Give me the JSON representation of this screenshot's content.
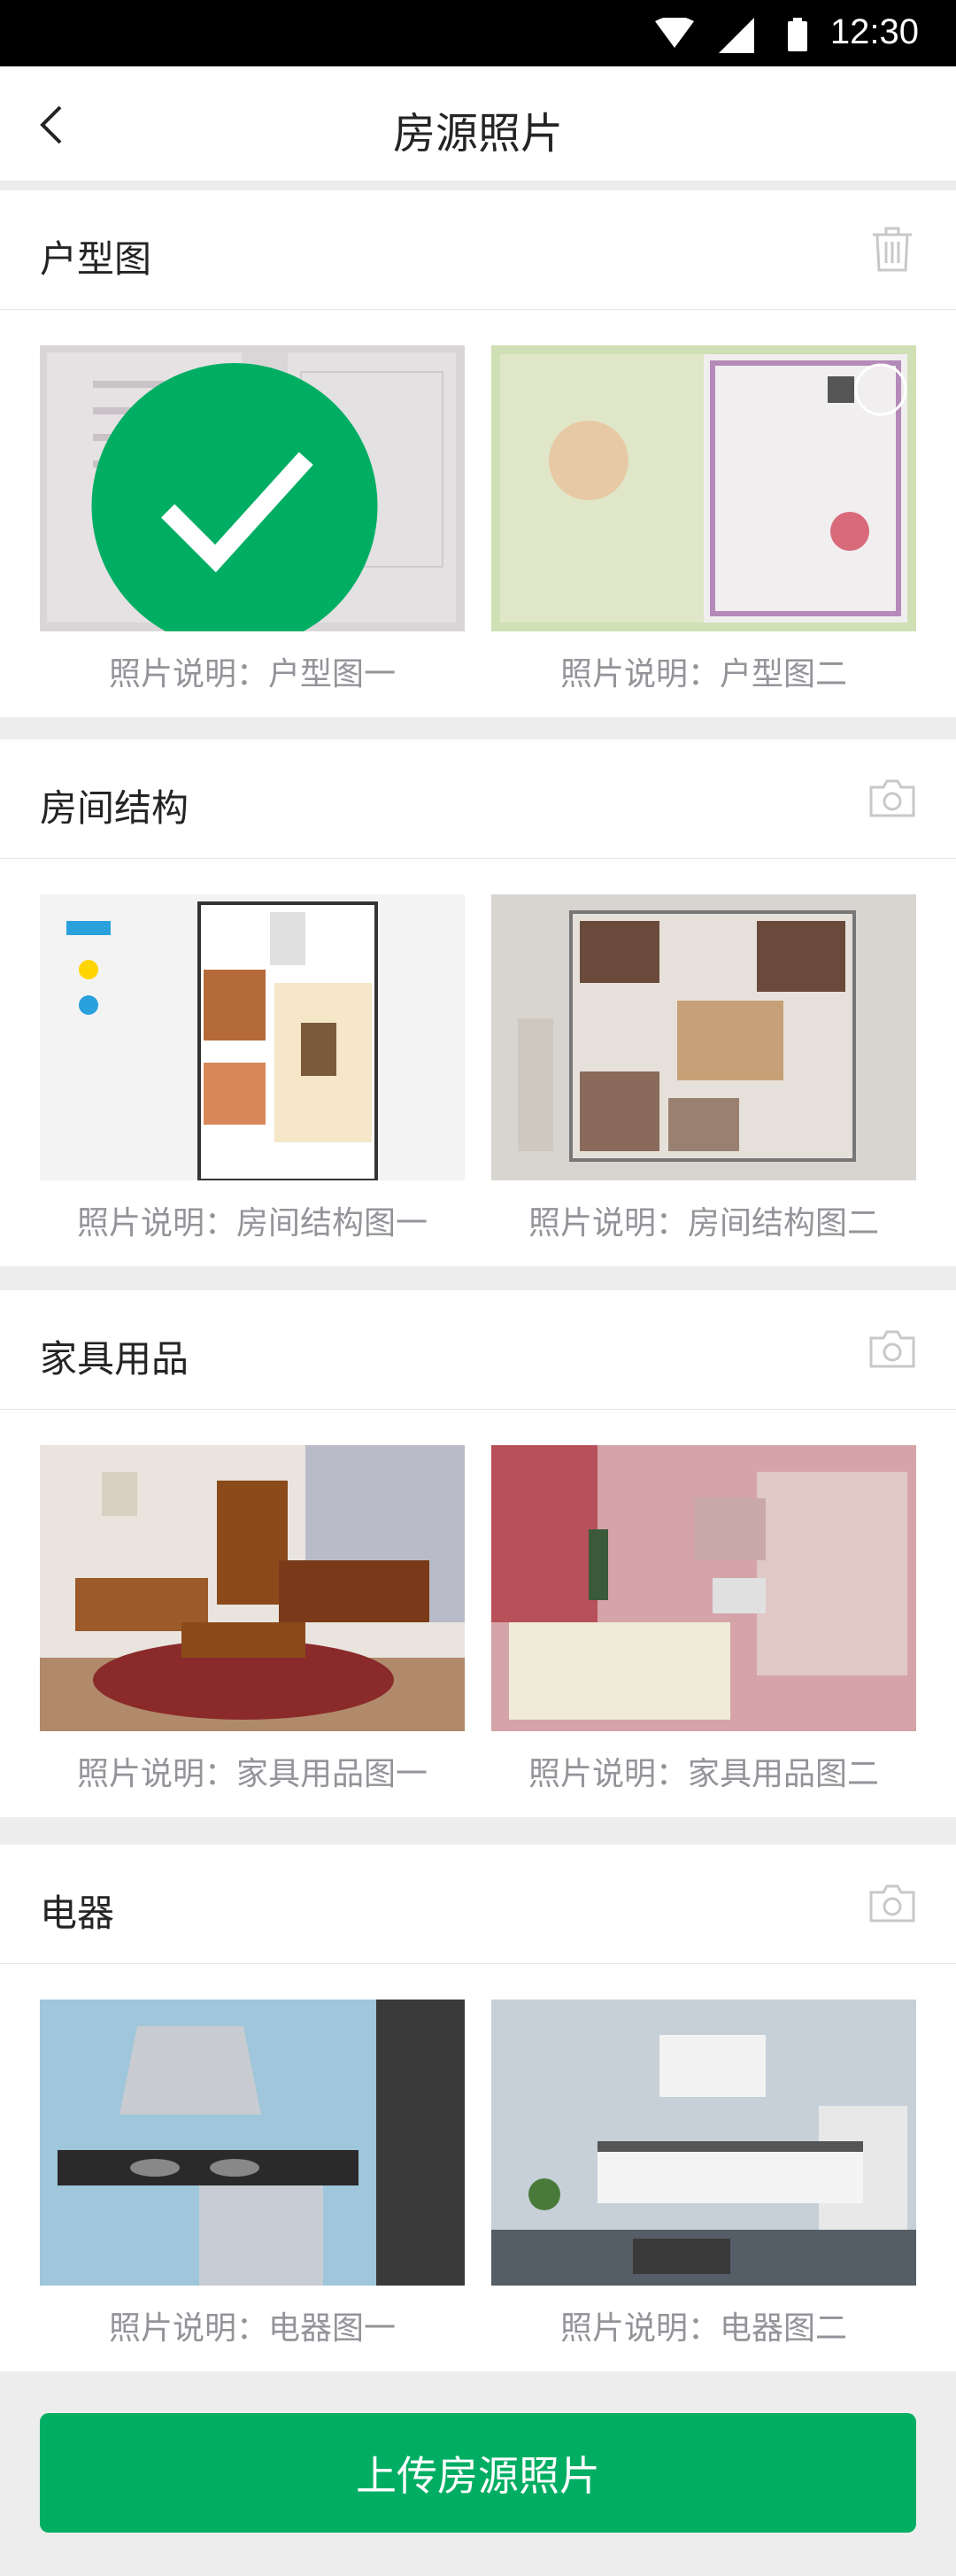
{
  "status_bar": {
    "time": "12:30",
    "wifi_icon": "wifi-icon",
    "signal_icon": "signal-icon",
    "battery_icon": "battery-icon"
  },
  "navbar": {
    "title": "房源照片",
    "back_icon": "back-icon"
  },
  "sections": [
    {
      "title": "户型图",
      "action_icon": "trash-icon",
      "photos": [
        {
          "caption": "照片说明：户型图一",
          "selected": true
        },
        {
          "caption": "照片说明：户型图二",
          "selected": false
        }
      ]
    },
    {
      "title": "房间结构",
      "action_icon": "camera-icon",
      "photos": [
        {
          "caption": "照片说明：房间结构图一"
        },
        {
          "caption": "照片说明：房间结构图二"
        }
      ]
    },
    {
      "title": "家具用品",
      "action_icon": "camera-icon",
      "photos": [
        {
          "caption": "照片说明：家具用品图一"
        },
        {
          "caption": "照片说明：家具用品图二"
        }
      ]
    },
    {
      "title": "电器",
      "action_icon": "camera-icon",
      "photos": [
        {
          "caption": "照片说明：电器图一"
        },
        {
          "caption": "照片说明：电器图二"
        }
      ]
    }
  ],
  "upload_button": {
    "label": "上传房源照片"
  },
  "colors": {
    "accent": "#00AE63",
    "title_text": "#242424",
    "caption_text": "#939499",
    "background": "#EDEDED"
  }
}
